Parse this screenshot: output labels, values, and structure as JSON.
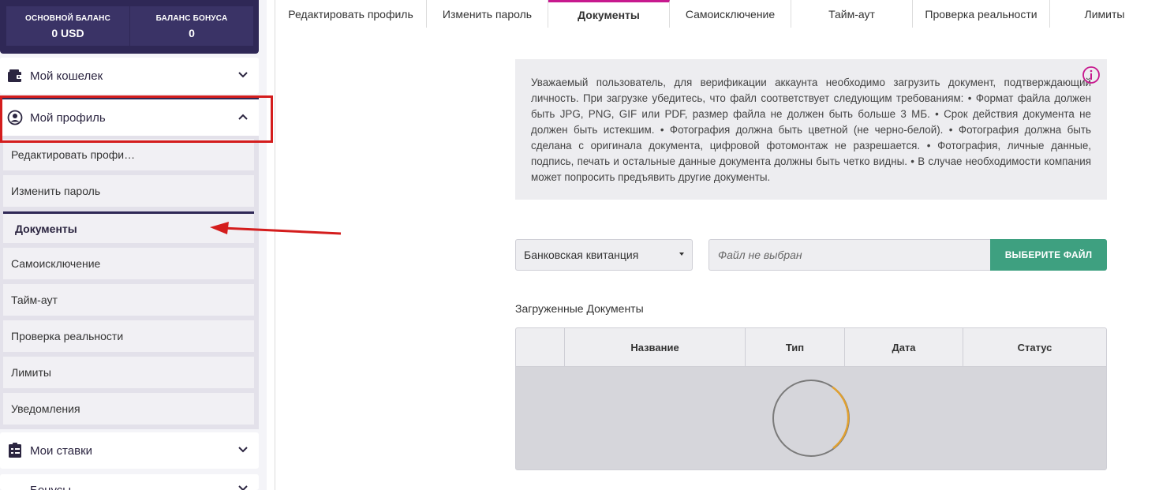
{
  "balance": {
    "main_label": "ОСНОВНОЙ БАЛАНС",
    "main_value": "0 USD",
    "bonus_label": "БАЛАНС БОНУСА",
    "bonus_value": "0"
  },
  "sidebar": {
    "wallet": {
      "label": "Мой кошелек",
      "icon": "wallet-icon"
    },
    "profile": {
      "label": "Мой профиль",
      "icon": "user-circle-icon"
    },
    "sub_items": [
      "Редактировать профи…",
      "Изменить пароль",
      "Документы",
      "Самоисключение",
      "Тайм-аут",
      "Проверка реальности",
      "Лимиты",
      "Уведомления"
    ],
    "bets": {
      "label": "Мои ставки",
      "icon": "clipboard-icon"
    },
    "bonuses": {
      "label": "Бонусы",
      "icon": "gift-icon"
    }
  },
  "tabs": [
    "Редактировать профиль",
    "Изменить пароль",
    "Документы",
    "Самоисключение",
    "Тайм-аут",
    "Проверка реальности",
    "Лимиты"
  ],
  "active_tab": "Документы",
  "info": {
    "text": "Уважаемый пользователь, для верификации аккаунта необходимо загрузить документ, подтверждающий личность. При загрузке убедитесь, что файл соответствует следующим требованиям: • Формат файла должен быть JPG, PNG, GIF или PDF, размер файла не должен быть больше 3 МБ. • Срок действия документа не должен быть истекшим. • Фотография должна быть цветной (не черно-белой). • Фотография должна быть сделана с оригинала документа, цифровой фотомонтаж не разрешается. • Фотография, личные данные, подпись, печать и остальные данные документа должны быть четко видны. • В случае необходимости компания может попросить предъявить другие документы."
  },
  "upload": {
    "doc_type": "Банковская квитанция",
    "file_placeholder": "Файл не выбран",
    "choose_button": "ВЫБЕРИТЕ ФАЙЛ"
  },
  "uploaded": {
    "title": "Загруженные Документы",
    "columns": [
      "",
      "Название",
      "Тип",
      "Дата",
      "Статус"
    ]
  },
  "colors": {
    "sidebar_dark": "#2f2856",
    "tab_accent": "#c7198e",
    "button_green": "#3ea080",
    "annotation_red": "#d41d1d",
    "spinner_accent": "#e0a030"
  }
}
